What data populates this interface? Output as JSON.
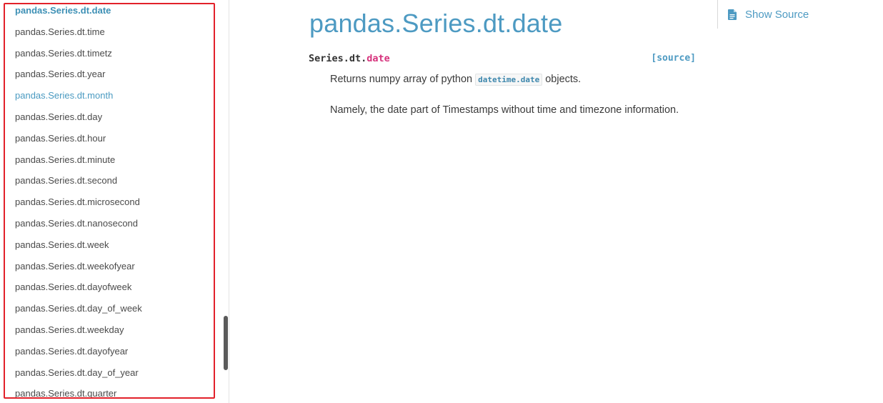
{
  "sidebar": {
    "items": [
      {
        "label": "pandas.Series.dt.date",
        "state": "active"
      },
      {
        "label": "pandas.Series.dt.time",
        "state": ""
      },
      {
        "label": "pandas.Series.dt.timetz",
        "state": ""
      },
      {
        "label": "pandas.Series.dt.year",
        "state": ""
      },
      {
        "label": "pandas.Series.dt.month",
        "state": "hover"
      },
      {
        "label": "pandas.Series.dt.day",
        "state": ""
      },
      {
        "label": "pandas.Series.dt.hour",
        "state": ""
      },
      {
        "label": "pandas.Series.dt.minute",
        "state": ""
      },
      {
        "label": "pandas.Series.dt.second",
        "state": ""
      },
      {
        "label": "pandas.Series.dt.microsecond",
        "state": ""
      },
      {
        "label": "pandas.Series.dt.nanosecond",
        "state": ""
      },
      {
        "label": "pandas.Series.dt.week",
        "state": ""
      },
      {
        "label": "pandas.Series.dt.weekofyear",
        "state": ""
      },
      {
        "label": "pandas.Series.dt.dayofweek",
        "state": ""
      },
      {
        "label": "pandas.Series.dt.day_of_week",
        "state": ""
      },
      {
        "label": "pandas.Series.dt.weekday",
        "state": ""
      },
      {
        "label": "pandas.Series.dt.dayofyear",
        "state": ""
      },
      {
        "label": "pandas.Series.dt.day_of_year",
        "state": ""
      },
      {
        "label": "pandas.Series.dt.quarter",
        "state": ""
      }
    ]
  },
  "main": {
    "title": "pandas.Series.dt.date",
    "signature": {
      "prefix": "Series.dt.",
      "name": "date",
      "source_link": "[source]"
    },
    "description": {
      "before_code": "Returns numpy array of python ",
      "code": "datetime.date",
      "after_code": " objects.",
      "line2": "Namely, the date part of Timestamps without time and timezone information."
    }
  },
  "show_source": {
    "label": "Show Source",
    "icon": "document-icon"
  },
  "colors": {
    "accent": "#4d9ac2",
    "signature_name": "#d6327c",
    "highlight_box": "#e2212a"
  }
}
